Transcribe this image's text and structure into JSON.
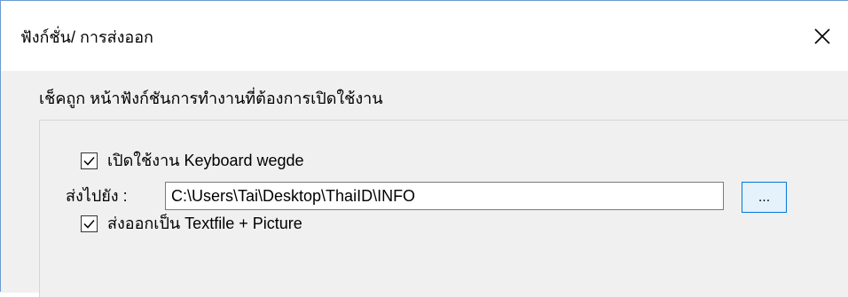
{
  "window": {
    "title": "ฟังก์ชั่น/ การส่งออก",
    "close_glyph": "✕"
  },
  "instruction": "เช็คถูก หน้าฟังก์ชันการทำงานที่ต้องการเปิดใช้งาน",
  "options": [
    {
      "label": "เปิดใช้งาน Keyboard wegde",
      "checked": true
    },
    {
      "label": "ส่งออกเป็น Textfile + Picture",
      "checked": true
    }
  ],
  "destination": {
    "label": "ส่งไปยัง :",
    "path": "C:\\Users\\Tai\\Desktop\\ThaiID\\INFO",
    "browse_label": "..."
  },
  "colors": {
    "accent": "#0078d7",
    "client_bg": "#f0f0f0",
    "window_border": "#6b9bd2"
  },
  "icons": {
    "close": "close-icon",
    "check": "checkmark-icon"
  }
}
